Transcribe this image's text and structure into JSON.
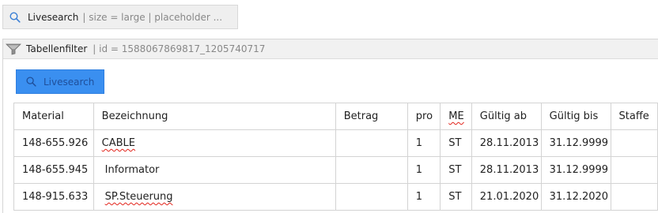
{
  "livesearch_chip": {
    "title": "Livesearch",
    "meta": "| size = large | placeholder ..."
  },
  "filter_panel": {
    "title": "Tabellenfilter",
    "meta": "| id = 1588067869817_1205740717",
    "search_button_label": "Livesearch"
  },
  "table": {
    "headers": {
      "material": "Material",
      "bezeichnung": "Bezeichnung",
      "betrag": "Betrag",
      "pro": "pro",
      "me": "ME",
      "gueltig_ab": "Gültig ab",
      "gueltig_bis": "Gültig bis",
      "staffel": "Staffe"
    },
    "rows": [
      {
        "material": "148-655.926",
        "bezeichnung": "CABLE",
        "betrag": "",
        "pro": "1",
        "me": "ST",
        "gueltig_ab": "28.11.2013",
        "gueltig_bis": "31.12.9999",
        "staffel": ""
      },
      {
        "material": "148-655.945",
        "bezeichnung": "Informator",
        "betrag": "",
        "pro": "1",
        "me": "ST",
        "gueltig_ab": "28.11.2013",
        "gueltig_bis": "31.12.9999",
        "staffel": ""
      },
      {
        "material": "148-915.633",
        "bezeichnung": "SP.Steuerung",
        "betrag": "",
        "pro": "1",
        "me": "ST",
        "gueltig_ab": "21.01.2020",
        "gueltig_bis": "31.12.2020",
        "staffel": ""
      }
    ]
  },
  "icons": {
    "chip_icon": "search-icon",
    "filter_icon": "funnel-icon",
    "button_icon": "search-icon"
  },
  "colors": {
    "button_bg": "#3a8ff0",
    "spellcheck": "#e2231a"
  }
}
